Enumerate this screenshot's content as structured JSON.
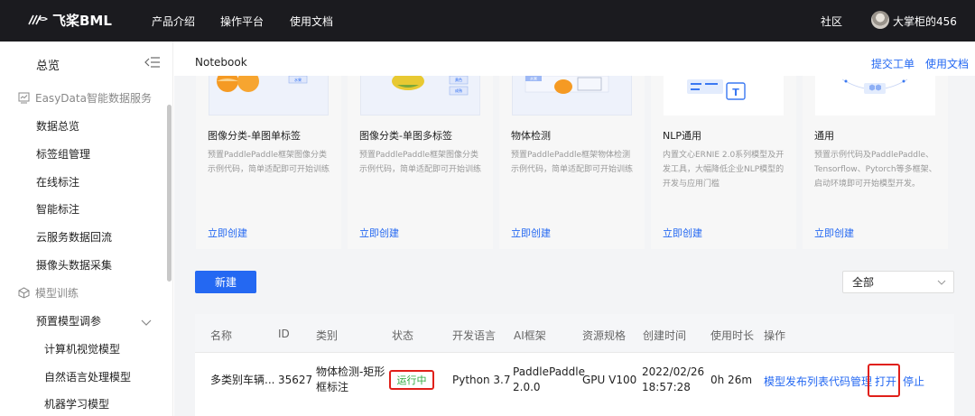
{
  "topbar": {
    "brand": "飞桨BML",
    "nav": [
      "产品介绍",
      "操作平台",
      "使用文档"
    ],
    "community": "社区",
    "username": "大掌柜的456"
  },
  "sidebar": {
    "overview": "总览",
    "group_easydata": "EasyData智能数据服务",
    "easydata_items": [
      "数据总览",
      "标签组管理",
      "在线标注",
      "智能标注",
      "云服务数据回流",
      "摄像头数据采集"
    ],
    "group_model": "模型训练",
    "preset_tuning": "预置模型调参",
    "preset_items": [
      "计算机视觉模型",
      "自然语言处理模型",
      "机器学习模型"
    ]
  },
  "header": {
    "title": "Notebook",
    "submit_ticket": "提交工单",
    "docs": "使用文档"
  },
  "cards": [
    {
      "title": "图像分类-单图单标签",
      "desc": "预置PaddlePaddle框架图像分类示例代码，简单适配即可开始训练",
      "link": "立即创建",
      "tag": "水果"
    },
    {
      "title": "图像分类-单图多标签",
      "desc": "预置PaddlePaddle框架图像分类示例代码，简单适配即可开始训练",
      "link": "立即创建",
      "tags": [
        "黄色",
        "成熟"
      ]
    },
    {
      "title": "物体检测",
      "desc": "预置PaddlePaddle框架物体检测示例代码，简单适配即可开始训练",
      "link": "立即创建",
      "tag": "水果"
    },
    {
      "title": "NLP通用",
      "desc": "内置文心ERNIE 2.0系列模型及开发工具，大幅降低企业NLP模型的开发与应用门槛",
      "link": "立即创建"
    },
    {
      "title": "通用",
      "desc": "预置示例代码及PaddlePaddle、Tensorflow、Pytorch等多框架、启动环境即可开始模型开发。",
      "link": "立即创建"
    }
  ],
  "toolbar": {
    "new_button": "新建",
    "filter_value": "全部"
  },
  "table": {
    "columns": [
      "名称",
      "ID",
      "类别",
      "状态",
      "开发语言",
      "AI框架",
      "资源规格",
      "创建时间",
      "使用时长",
      "操作"
    ],
    "rows": [
      {
        "name": "多类别车辆...",
        "id": "35627",
        "category_line1": "物体检测-矩形",
        "category_line2": "框标注",
        "status": "运行中",
        "language": "Python 3.7",
        "framework_line1": "PaddlePaddle",
        "framework_line2": "2.0.0",
        "resource": "GPU V100",
        "created_line1": "2022/02/26",
        "created_line2": "18:57:28",
        "duration": "0h 26m",
        "actions": [
          "模型发布列表",
          "代码管理",
          "打开",
          "停止"
        ]
      }
    ]
  },
  "colors": {
    "topbar_bg": "#1b1b1f",
    "accent": "#2468f2",
    "status_running": "#2eaa3f",
    "highlight_red": "#e0201a"
  }
}
